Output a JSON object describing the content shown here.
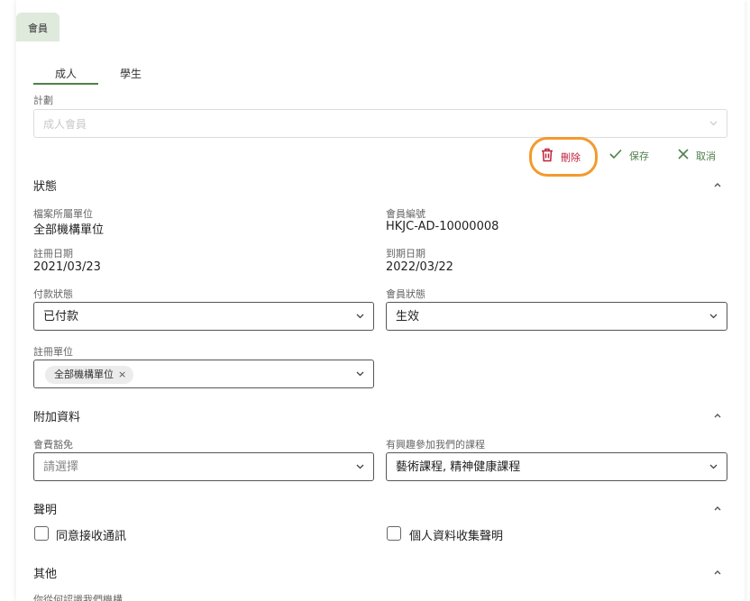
{
  "page_tab": "會員",
  "subtabs": [
    {
      "label": "成人",
      "active": true
    },
    {
      "label": "學生",
      "active": false
    }
  ],
  "plan": {
    "label": "計劃",
    "value": "成人會員"
  },
  "actions": {
    "delete": "刪除",
    "save": "保存",
    "cancel": "取消"
  },
  "status_section": {
    "title": "狀態",
    "file_unit_label": "檔案所屬單位",
    "file_unit_value": "全部機構單位",
    "member_no_label": "會員編號",
    "member_no_value": "HKJC-AD-10000008",
    "reg_date_label": "註冊日期",
    "reg_date_value": "2021/03/23",
    "expiry_label": "到期日期",
    "expiry_value": "2022/03/22",
    "payment_label": "付款狀態",
    "payment_value": "已付款",
    "member_status_label": "會員狀態",
    "member_status_value": "生效",
    "reg_unit_label": "註冊單位",
    "reg_unit_chip": "全部機構單位",
    "chip_remove": "×"
  },
  "extra_section": {
    "title": "附加資料",
    "fee_waiver_label": "會費豁免",
    "fee_waiver_placeholder": "請選擇",
    "courses_label": "有興趣參加我們的課程",
    "courses_value": "藝術課程, 精神健康課程"
  },
  "declaration_section": {
    "title": "聲明",
    "consent_notify": "同意接收通訊",
    "privacy": "個人資料收集聲明"
  },
  "other_section": {
    "title": "其他",
    "how_known_label": "你從何認識我們機構"
  },
  "colors": {
    "accent_green": "#4f7f4a",
    "delete_red": "#c0223a",
    "highlight_orange": "#f39a2e",
    "tab_bg": "#dfe9dc"
  }
}
